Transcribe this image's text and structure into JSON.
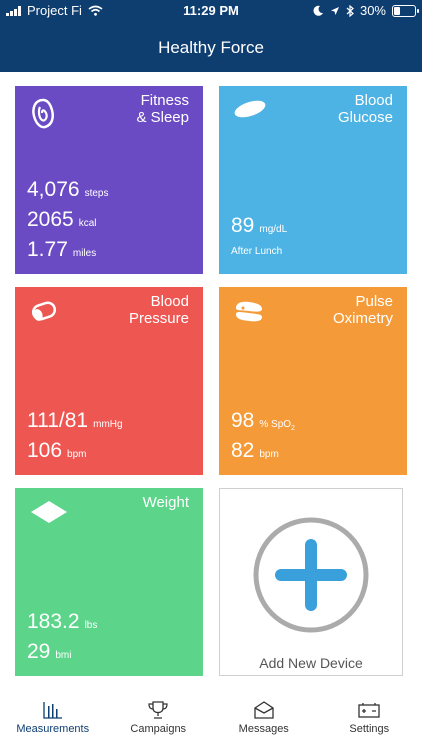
{
  "status_bar": {
    "carrier": "Project Fi",
    "time": "11:29 PM",
    "battery": "30%",
    "battery_level": 0.3
  },
  "header": {
    "title": "Healthy Force"
  },
  "tiles": {
    "fitness": {
      "title_line1": "Fitness",
      "title_line2": "& Sleep",
      "steps_value": "4,076",
      "steps_unit": "steps",
      "kcal_value": "2065",
      "kcal_unit": "kcal",
      "miles_value": "1.77",
      "miles_unit": "miles",
      "color": "#6b4bc4",
      "icon": "fitness-tracker-icon"
    },
    "glucose": {
      "title_line1": "Blood",
      "title_line2": "Glucose",
      "value": "89",
      "unit": "mg/dL",
      "note": "After Lunch",
      "color": "#4cb3e4",
      "icon": "glucose-strip-icon"
    },
    "pressure": {
      "title_line1": "Blood",
      "title_line2": "Pressure",
      "bp_value": "111/81",
      "bp_unit": "mmHg",
      "pulse_value": "106",
      "pulse_unit": "bpm",
      "color": "#ee5652",
      "icon": "blood-pressure-cuff-icon"
    },
    "pulse_ox": {
      "title_line1": "Pulse",
      "title_line2": "Oximetry",
      "spo2_value": "98",
      "spo2_unit": "% SpO",
      "spo2_sub": "2",
      "bpm_value": "82",
      "bpm_unit": "bpm",
      "color": "#f49a38",
      "icon": "pulse-oximeter-icon"
    },
    "weight": {
      "title": "Weight",
      "weight_value": "183.2",
      "weight_unit": "lbs",
      "bmi_value": "29",
      "bmi_unit": "bmi",
      "color": "#5cd58a",
      "icon": "scale-icon"
    },
    "add_device": {
      "label": "Add New Device",
      "icon": "plus-icon",
      "accent": "#3aa0dc"
    }
  },
  "tabbar": {
    "items": [
      {
        "label": "Measurements",
        "icon": "bar-chart-icon",
        "active": true
      },
      {
        "label": "Campaigns",
        "icon": "trophy-icon",
        "active": false
      },
      {
        "label": "Messages",
        "icon": "envelope-icon",
        "active": false
      },
      {
        "label": "Settings",
        "icon": "settings-panel-icon",
        "active": false
      }
    ]
  }
}
